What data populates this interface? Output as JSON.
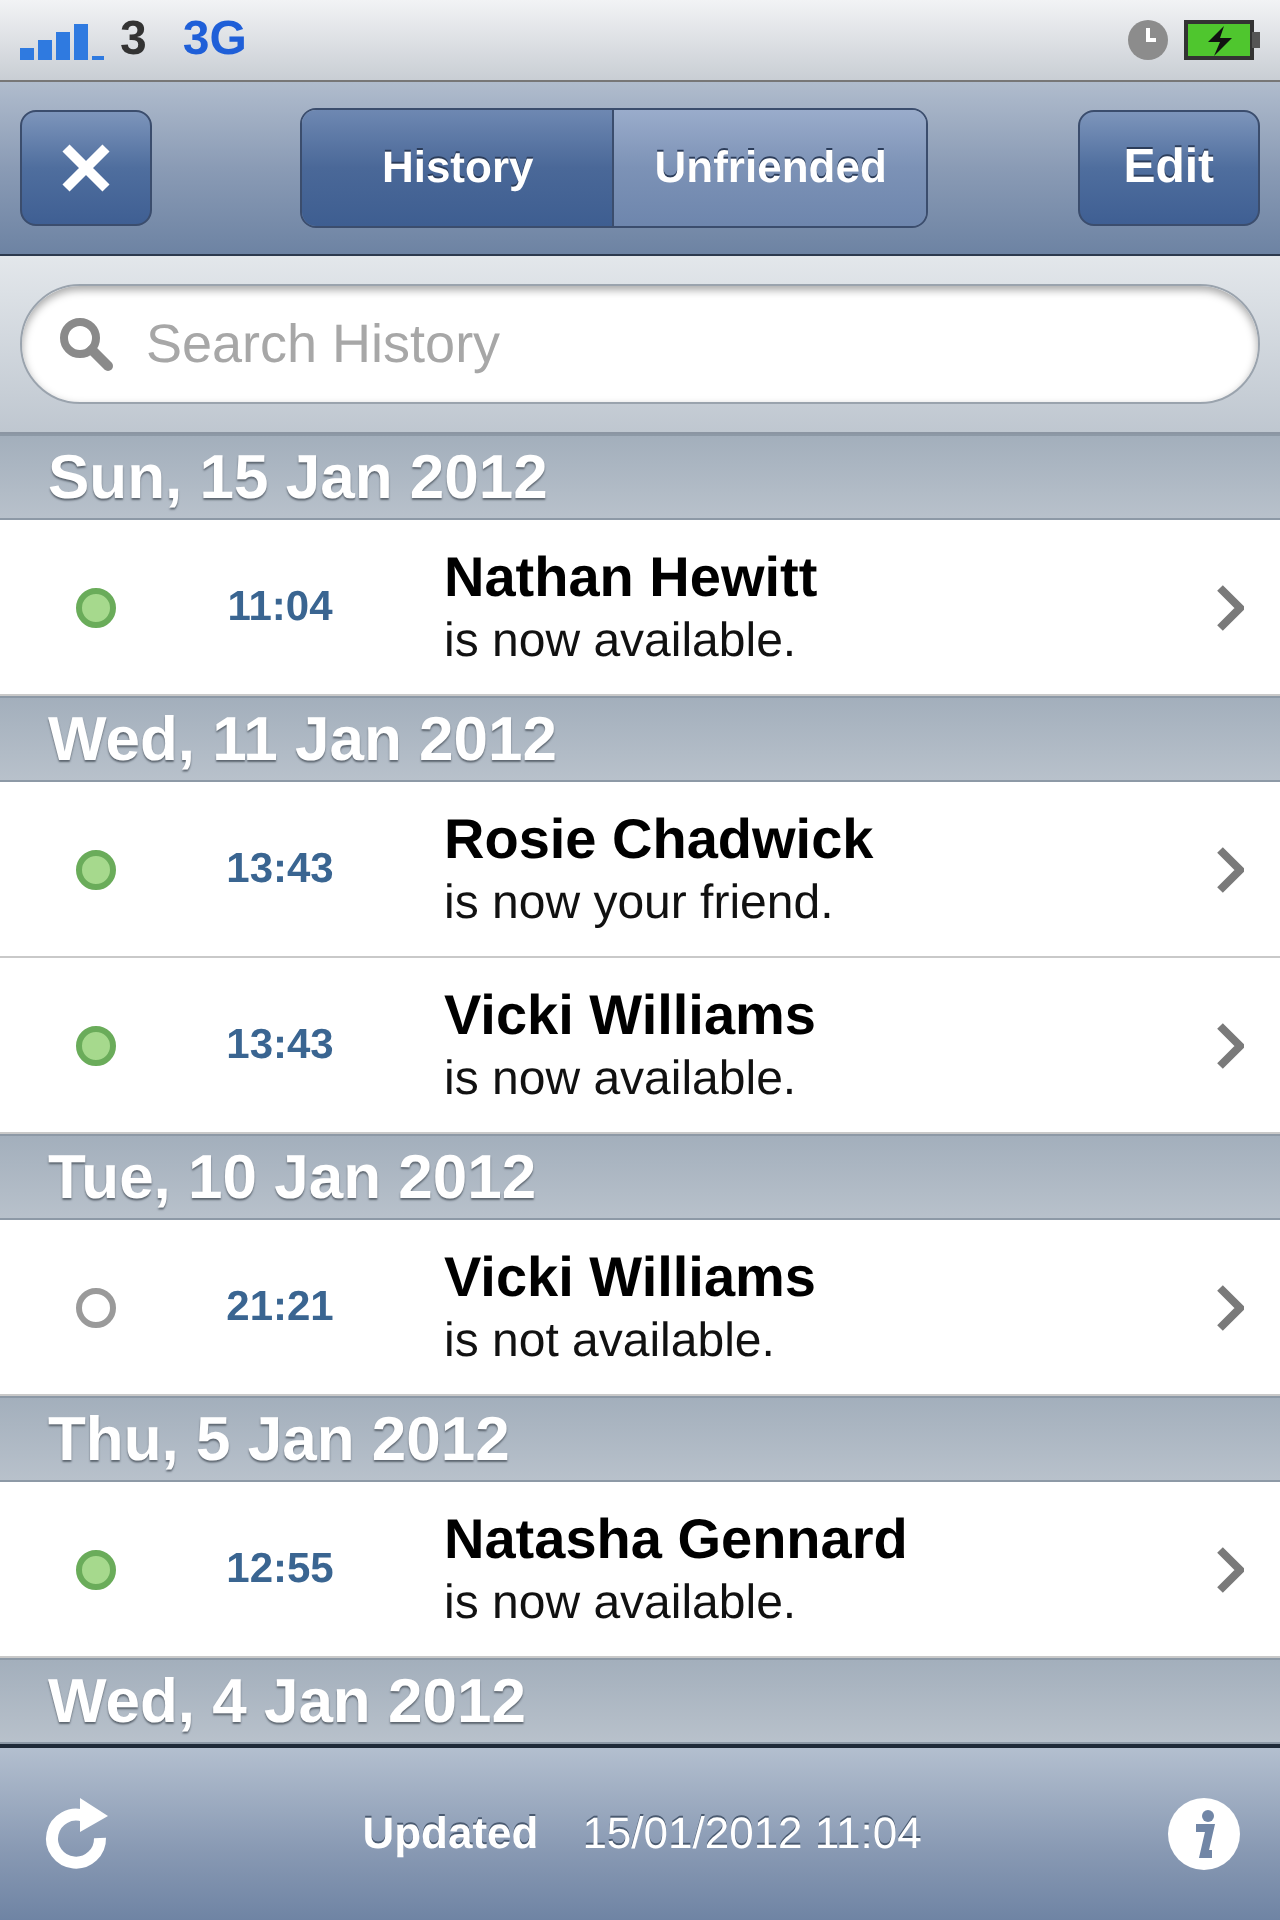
{
  "status_bar": {
    "carrier": "3",
    "network": "3G"
  },
  "nav": {
    "tabs": [
      {
        "label": "History",
        "selected": true
      },
      {
        "label": "Unfriended",
        "selected": false
      }
    ],
    "edit_button": "Edit"
  },
  "search": {
    "placeholder": "Search History"
  },
  "sections": [
    {
      "date": "Sun, 15 Jan 2012",
      "items": [
        {
          "online": true,
          "time": "11:04",
          "name": "Nathan Hewitt",
          "message": "is now available."
        }
      ]
    },
    {
      "date": "Wed, 11 Jan 2012",
      "items": [
        {
          "online": true,
          "time": "13:43",
          "name": "Rosie Chadwick",
          "message": "is now your friend."
        },
        {
          "online": true,
          "time": "13:43",
          "name": "Vicki Williams",
          "message": "is now available."
        }
      ]
    },
    {
      "date": "Tue, 10 Jan 2012",
      "items": [
        {
          "online": false,
          "time": "21:21",
          "name": "Vicki Williams",
          "message": "is not available."
        }
      ]
    },
    {
      "date": "Thu, 5 Jan 2012",
      "items": [
        {
          "online": true,
          "time": "12:55",
          "name": "Natasha Gennard",
          "message": "is now available."
        }
      ]
    },
    {
      "date": "Wed, 4 Jan 2012"
    }
  ],
  "toolbar": {
    "label": "Updated",
    "timestamp": "15/01/2012 11:04"
  }
}
